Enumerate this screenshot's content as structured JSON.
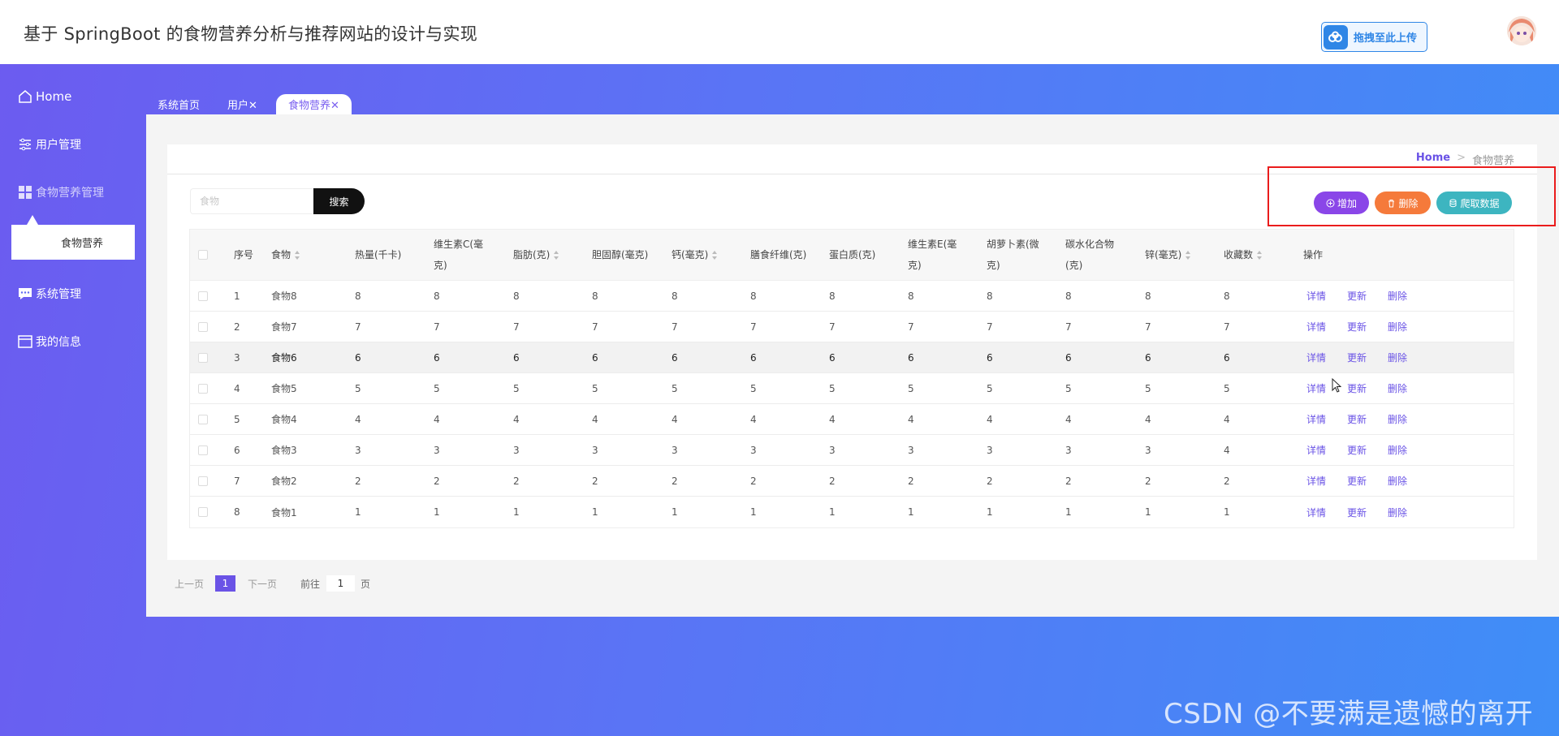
{
  "header": {
    "title": "基于 SpringBoot 的食物营养分析与推荐网站的设计与实现",
    "upload_label": "拖拽至此上传"
  },
  "sidebar": {
    "items": [
      {
        "label": "Home",
        "icon": "home-icon"
      },
      {
        "label": "用户管理",
        "icon": "sliders-icon"
      },
      {
        "label": "食物营养管理",
        "icon": "grid-icon"
      },
      {
        "label": "系统管理",
        "icon": "chat-icon"
      },
      {
        "label": "我的信息",
        "icon": "card-icon"
      }
    ],
    "subitem": "食物营养"
  },
  "tabs": [
    {
      "label": "系统首页"
    },
    {
      "label": "用户✕"
    },
    {
      "label": "食物营养✕"
    }
  ],
  "breadcrumb": {
    "home": "Home",
    "sep": ">",
    "current": "食物营养"
  },
  "search": {
    "placeholder": "食物",
    "button": "搜索"
  },
  "actions": {
    "add": "增加",
    "delete": "删除",
    "crawl": "爬取数据"
  },
  "table": {
    "headers": [
      "序号",
      "食物",
      "热量(千卡)",
      "维生素C(毫\n克)",
      "脂肪(克)",
      "胆固醇(毫克)",
      "钙(毫克)",
      "膳食纤维(克)",
      "蛋白质(克)",
      "维生素E(毫\n克)",
      "胡萝卜素(微\n克)",
      "碳水化合物\n(克)",
      "锌(毫克)",
      "收藏数",
      "操作"
    ],
    "rows": [
      {
        "idx": "1",
        "food": "食物8",
        "vals": [
          "8",
          "8",
          "8",
          "8",
          "8",
          "8",
          "8",
          "8",
          "8",
          "8",
          "8",
          "8"
        ]
      },
      {
        "idx": "2",
        "food": "食物7",
        "vals": [
          "7",
          "7",
          "7",
          "7",
          "7",
          "7",
          "7",
          "7",
          "7",
          "7",
          "7",
          "7"
        ]
      },
      {
        "idx": "3",
        "food": "食物6",
        "vals": [
          "6",
          "6",
          "6",
          "6",
          "6",
          "6",
          "6",
          "6",
          "6",
          "6",
          "6",
          "6"
        ]
      },
      {
        "idx": "4",
        "food": "食物5",
        "vals": [
          "5",
          "5",
          "5",
          "5",
          "5",
          "5",
          "5",
          "5",
          "5",
          "5",
          "5",
          "5"
        ]
      },
      {
        "idx": "5",
        "food": "食物4",
        "vals": [
          "4",
          "4",
          "4",
          "4",
          "4",
          "4",
          "4",
          "4",
          "4",
          "4",
          "4",
          "4"
        ]
      },
      {
        "idx": "6",
        "food": "食物3",
        "vals": [
          "3",
          "3",
          "3",
          "3",
          "3",
          "3",
          "3",
          "3",
          "3",
          "3",
          "3",
          "4"
        ]
      },
      {
        "idx": "7",
        "food": "食物2",
        "vals": [
          "2",
          "2",
          "2",
          "2",
          "2",
          "2",
          "2",
          "2",
          "2",
          "2",
          "2",
          "2"
        ]
      },
      {
        "idx": "8",
        "food": "食物1",
        "vals": [
          "1",
          "1",
          "1",
          "1",
          "1",
          "1",
          "1",
          "1",
          "1",
          "1",
          "1",
          "1"
        ]
      }
    ],
    "ops": {
      "detail": "详情",
      "update": "更新",
      "delete": "删除"
    }
  },
  "pagination": {
    "prev": "上一页",
    "current": "1",
    "next": "下一页",
    "goto_label": "前往",
    "goto_value": "1",
    "page_unit": "页"
  },
  "watermark": "CSDN @不要满是遗憾的离开",
  "colors": {
    "accent": "#6a53e6",
    "add": "#8a46e8",
    "delete": "#f57a3b",
    "crawl": "#3db5c0",
    "highlight": "#ea1c1c"
  }
}
